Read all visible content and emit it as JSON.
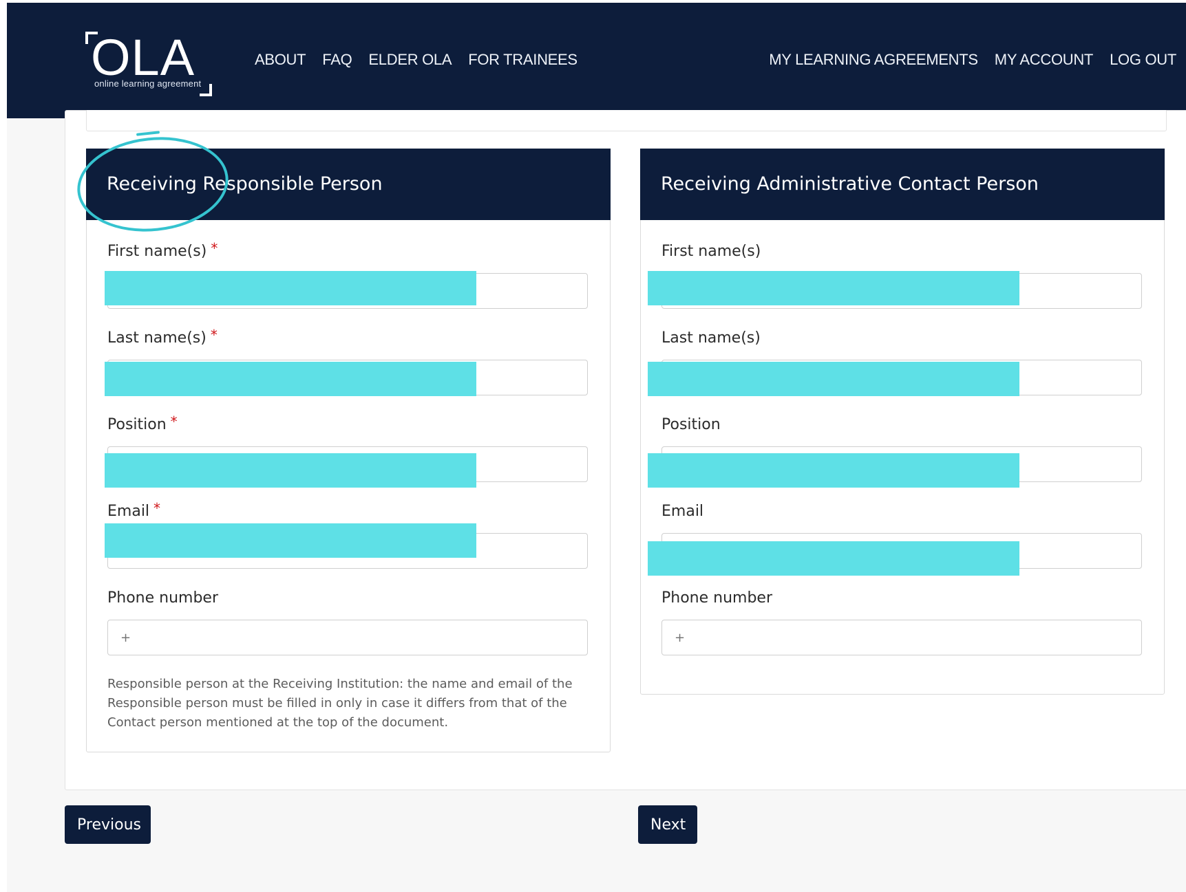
{
  "brand": {
    "name": "OLA",
    "tagline": "online learning agreement"
  },
  "nav": {
    "left": [
      "ABOUT",
      "FAQ",
      "ELDER OLA",
      "FOR TRAINEES"
    ],
    "right": [
      "MY LEARNING AGREEMENTS",
      "MY ACCOUNT",
      "LOG OUT"
    ]
  },
  "left_panel": {
    "title": "Receiving Responsible Person",
    "fields": [
      {
        "label": "First name(s)",
        "required": "*",
        "value": ""
      },
      {
        "label": "Last name(s)",
        "required": "*",
        "value": ""
      },
      {
        "label": "Position",
        "required": "*",
        "value": ""
      },
      {
        "label": "Email",
        "required": "*",
        "value": ""
      },
      {
        "label": "Phone number",
        "placeholder": "+"
      }
    ],
    "help": "Responsible person at the Receiving Institution: the name and email of the Responsible person must be filled in only in case it differs from that of the Contact person mentioned at the top of the document."
  },
  "right_panel": {
    "title": "Receiving Administrative Contact Person",
    "fields": [
      {
        "label": "First name(s)",
        "value": ""
      },
      {
        "label": "Last name(s)",
        "value": ""
      },
      {
        "label": "Position",
        "value": ""
      },
      {
        "label": "Email",
        "value": ""
      },
      {
        "label": "Phone number",
        "placeholder": "+"
      }
    ]
  },
  "buttons": {
    "previous": "Previous",
    "next": "Next"
  },
  "colors": {
    "navy": "#0d1d3b",
    "redaction": "#5ee0e6",
    "annotation": "#35c3cf",
    "required": "#d0171b"
  }
}
